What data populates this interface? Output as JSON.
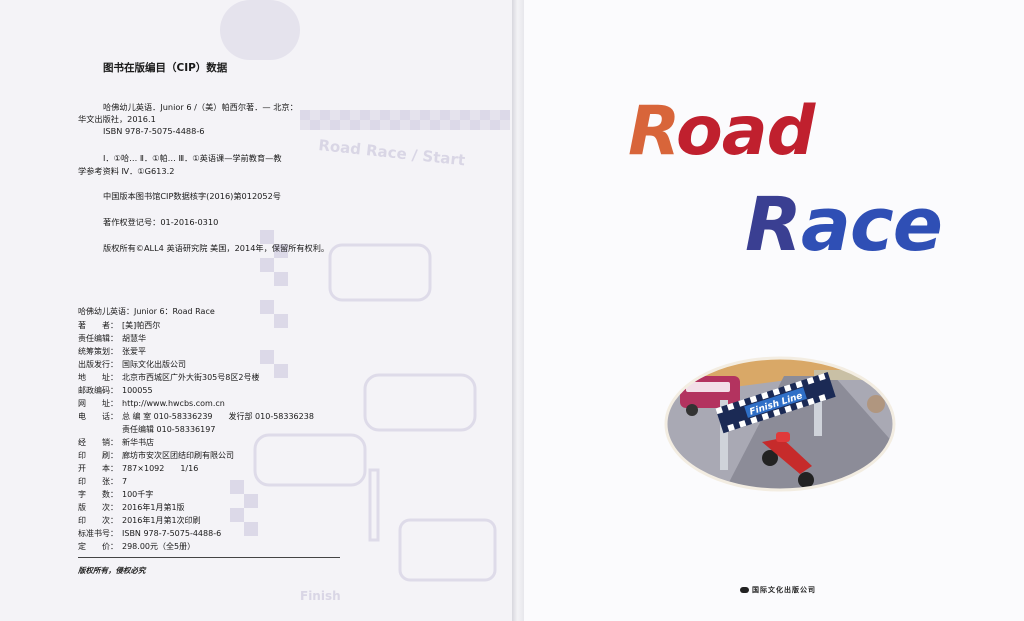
{
  "left_page": {
    "watermark_labels": {
      "road_race_start": "Road Race / Start",
      "finish": "Finish"
    },
    "cip": {
      "heading": "图书在版编目（CIP）数据",
      "line1": "哈佛幼儿英语．Junior 6 /（美）帕西尔著．— 北京：",
      "line2": "华文出版社，2016.1",
      "line3": "ISBN 978-7-5075-4488-6",
      "line4": "Ⅰ．①哈… Ⅱ．①帕… Ⅲ．①英语课—学前教育—教",
      "line5": "学参考资料 Ⅳ．①G613.2",
      "line6": "中国版本图书馆CIP数据核字(2016)第012052号",
      "line7": "著作权登记号：01-2016-0310",
      "line8": "版权所有©ALL4 英语研究院 美国，2014年，保留所有权利。"
    },
    "bib": {
      "title": "哈佛幼儿英语：Junior 6：Road Race",
      "rows": [
        {
          "label": "著　　者：",
          "value": "[美]帕西尔"
        },
        {
          "label": "责任编辑：",
          "value": "胡慧华"
        },
        {
          "label": "统筹策划：",
          "value": "张爱平"
        },
        {
          "label": "出版发行：",
          "value": "国际文化出版公司"
        },
        {
          "label": "地　　址：",
          "value": "北京市西城区广外大街305号8区2号楼"
        },
        {
          "label": "邮政编码：",
          "value": "100055"
        },
        {
          "label": "网　　址：",
          "value": "http://www.hwcbs.com.cn"
        },
        {
          "label": "电　　话：",
          "value": "总 编 室 010-58336239　　发行部 010-58336238"
        },
        {
          "label": "",
          "value": "责任编辑 010-58336197"
        },
        {
          "label": "经　　销：",
          "value": "新华书店"
        },
        {
          "label": "印　　刷：",
          "value": "廊坊市安次区团结印刷有限公司"
        },
        {
          "label": "开　　本：",
          "value": "787×1092　　1/16"
        },
        {
          "label": "印　　张：",
          "value": "7"
        },
        {
          "label": "字　　数：",
          "value": "100千字"
        },
        {
          "label": "版　　次：",
          "value": "2016年1月第1版"
        },
        {
          "label": "印　　次：",
          "value": "2016年1月第1次印刷"
        },
        {
          "label": "标准书号：",
          "value": "ISBN 978-7-5075-4488-6"
        },
        {
          "label": "定　　价：",
          "value": "298.00元（全5册）"
        }
      ],
      "footer": "版权所有，侵权必究"
    }
  },
  "right_page": {
    "title_word1": "Road",
    "title_word2": "Race",
    "colors": {
      "road_R": "#d8653a",
      "road_rest": "#c0202e",
      "race_R": "#3a3f92",
      "race_rest": "#2f4fb5"
    },
    "illustration": {
      "banner_text": "Finish Line"
    },
    "publisher": "国际文化出版公司"
  }
}
